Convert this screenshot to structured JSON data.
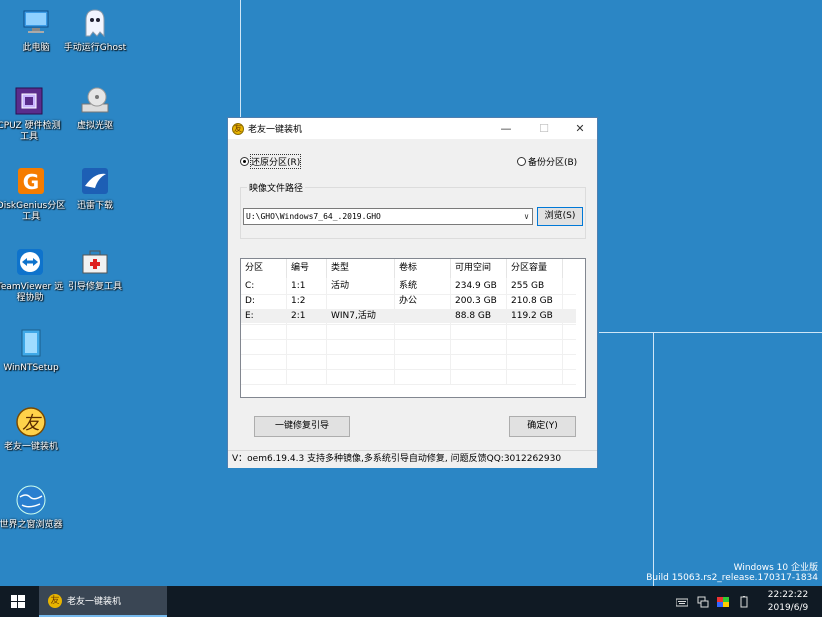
{
  "desktop": {
    "icons": [
      {
        "label": "此电脑"
      },
      {
        "label": "手动运行Ghost"
      },
      {
        "label": "CPUZ 硬件检测工具"
      },
      {
        "label": "虚拟光驱"
      },
      {
        "label": "DiskGenius分区工具"
      },
      {
        "label": "迅雷下载"
      },
      {
        "label": "TeamViewer 远程协助"
      },
      {
        "label": "引导修复工具"
      },
      {
        "label": "WinNTSetup"
      },
      {
        "label": "老友一键装机"
      },
      {
        "label": "世界之窗浏览器"
      }
    ],
    "watermark": {
      "line1": "Windows 10 企业版",
      "line2": "Build 15063.rs2_release.170317-1834"
    }
  },
  "window": {
    "title": "老友一键装机",
    "controls": {
      "min": "—",
      "max": "☐",
      "close": "✕"
    },
    "radio_restore": "还原分区(R)",
    "radio_backup": "备份分区(B)",
    "image_group_title": "映像文件路径",
    "image_path": "U:\\GHO\\Windows7_64_.2019.GHO",
    "browse_label": "浏览(S)",
    "table": {
      "headers": [
        "分区",
        "编号",
        "类型",
        "卷标",
        "可用空间",
        "分区容量"
      ],
      "rows": [
        [
          "C:",
          "1:1",
          "活动",
          "系统",
          "234.9 GB",
          "255 GB"
        ],
        [
          "D:",
          "1:2",
          "",
          "办公",
          "200.3 GB",
          "210.8 GB"
        ],
        [
          "E:",
          "2:1",
          "WIN7,活动",
          "",
          "88.8 GB",
          "119.2 GB"
        ]
      ]
    },
    "repair_button": "一键修复引导",
    "ok_button": "确定(Y)",
    "status": "V：oem6.19.4.3   支持多种镜像,多系统引导自动修复, 问题反馈QQ:3012262930"
  },
  "taskbar": {
    "task_label": "老友一键装机",
    "time": "22:22:22",
    "date": "2019/6/9"
  }
}
